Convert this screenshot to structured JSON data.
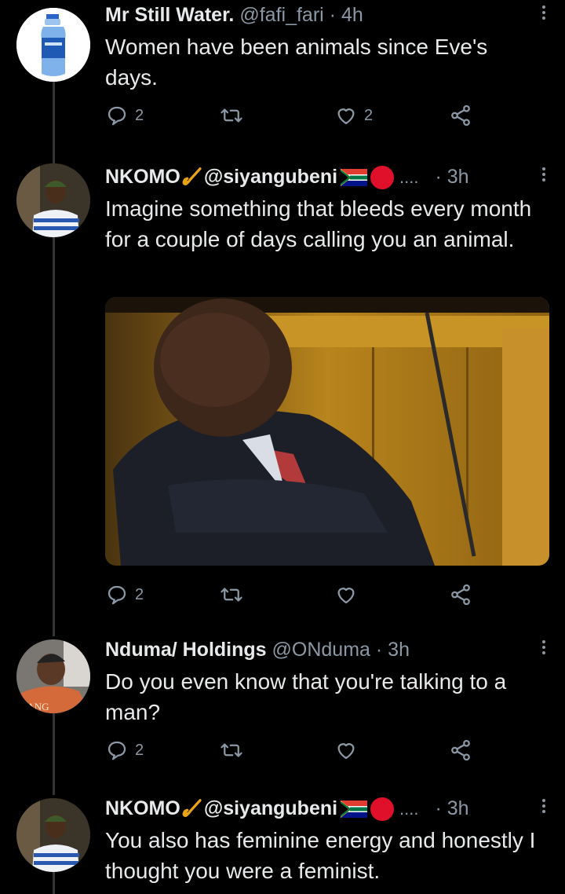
{
  "tweets": [
    {
      "name": "Mr Still Water.",
      "handle": "@fafi_fari",
      "time": "4h",
      "text": "Women have been animals since Eve's days.",
      "replies": "2",
      "retweets": "",
      "likes": "2"
    },
    {
      "name": "NKOMO",
      "handle": "@siyangubeni",
      "ellipsis": "....",
      "time": "3h",
      "text": "Imagine something that bleeds every month for a couple of days calling you an animal.",
      "replies": "2",
      "retweets": "",
      "likes": ""
    },
    {
      "name": "Nduma/ Holdings",
      "handle": "@ONduma",
      "time": "3h",
      "text": "Do you even know that you're talking to a man?",
      "replies": "2",
      "retweets": "",
      "likes": ""
    },
    {
      "name": "NKOMO",
      "handle": "@siyangubeni",
      "ellipsis": "....",
      "time": "3h",
      "text": "You also has feminine energy and honestly I thought you were a feminist."
    }
  ],
  "separator": "·",
  "icons": {
    "reply": "reply-icon",
    "retweet": "retweet-icon",
    "like": "heart-icon",
    "share": "share-icon",
    "more": "more-icon"
  },
  "colors": {
    "background": "#000000",
    "text": "#e7e9ea",
    "secondary": "#8b98a5",
    "thread_line": "#333639"
  }
}
